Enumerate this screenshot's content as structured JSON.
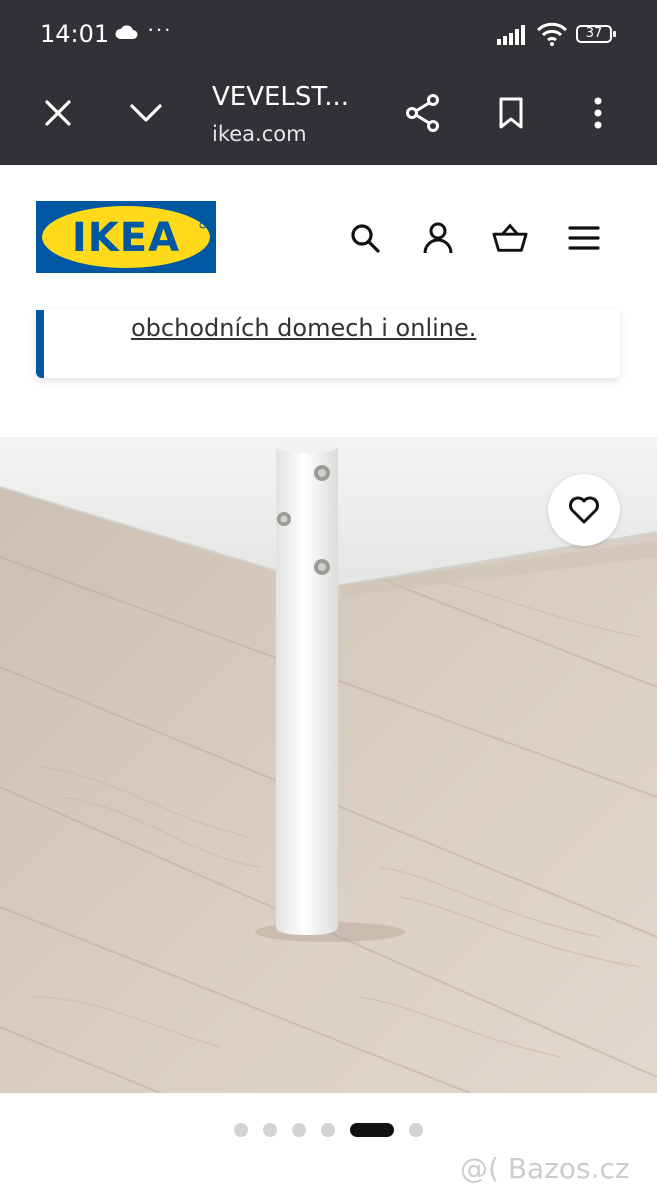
{
  "status_bar": {
    "time": "14:01",
    "overflow_dots": "···",
    "battery": "37"
  },
  "browser": {
    "title": "VEVELST...",
    "url": "ikea.com"
  },
  "header": {
    "logo_text": "IKEA",
    "brand_blue": "#0058a3",
    "brand_yellow": "#ffda1a"
  },
  "notice": {
    "link_text": "obchodních domech i online."
  },
  "gallery": {
    "image_alt": "product photo",
    "slide_count": 6,
    "active_index": 4
  },
  "watermark": "@( Bazos.cz"
}
